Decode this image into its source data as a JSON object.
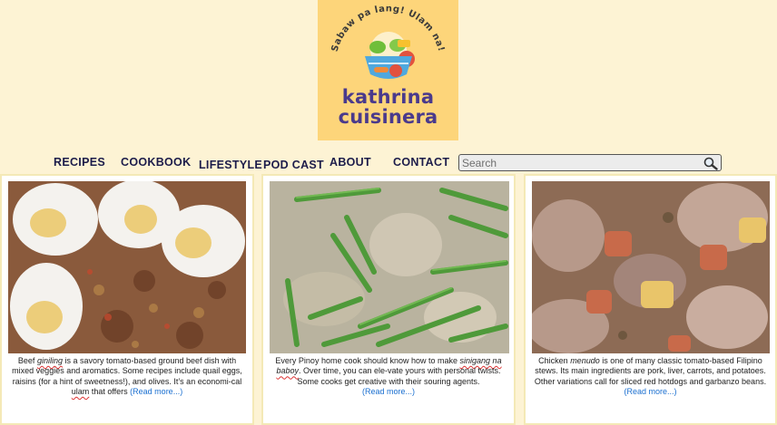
{
  "logo": {
    "tagline": "Sabaw pa lang! Ulam na!",
    "brand_line1": "kathrina",
    "brand_line2": "cuisinera"
  },
  "nav": {
    "items": [
      "RECIPES",
      "COOKBOOK",
      "LIFESTYLE",
      "POD CAST",
      "ABOUT",
      "CONTACT"
    ]
  },
  "search": {
    "placeholder": "Search",
    "icon": "magnifier-icon"
  },
  "cards": [
    {
      "image": "giniling-with-boiled-eggs",
      "text_before": "Beef ",
      "term": "giniling",
      "text_after": " is a savory tomato-based ground beef dish with mixed veggies and aromatics. Some recipes include quail eggs, raisins (for a hint of sweetness!), and olives.  It’s an economi-cal ",
      "term2": "ulam",
      "text_end": " that offers ",
      "more": "(Read more...)"
    },
    {
      "image": "sinigang-na-baboy-with-string-beans",
      "text_before": "Every Pinoy home cook should know how to make ",
      "term": "sinigang na baboy",
      "text_after": ". Over time, you can ele-vate yours with personal twists. Some cooks get creative with their souring agents.",
      "more": "(Read more...)"
    },
    {
      "image": "chicken-menudo",
      "text_before": "Chicken ",
      "term": "menudo",
      "text_after": " is one of many classic tomato-based Filipino stews. Its main ingredients are pork, liver, carrots, and potatoes. Other variations call for sliced red hotdogs and garbanzo beans.",
      "more": "(Read more...)"
    }
  ],
  "colors": {
    "page_bg": "#fdf3d4",
    "logo_bg": "#fdd57a",
    "brand_text": "#4a3a8c",
    "nav_text": "#1c1c4a",
    "link": "#1a6fd0"
  }
}
